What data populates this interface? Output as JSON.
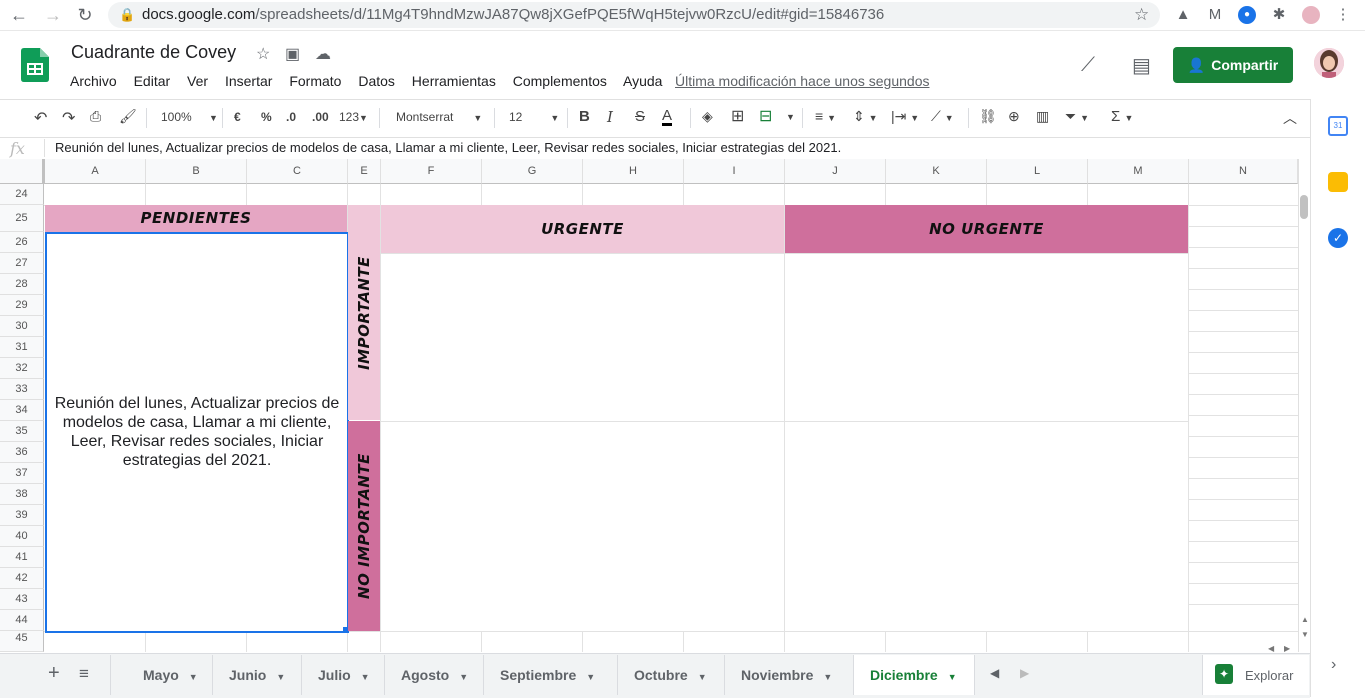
{
  "browser": {
    "url_domain": "docs.google.com",
    "url_path": "/spreadsheets/d/11Mg4T9hndMzwJA87Qw8jXGefPQE5fWqH5tejvw0RzcU/edit#gid=15846736"
  },
  "doc": {
    "title": "Cuadrante de Covey",
    "menus": [
      "Archivo",
      "Editar",
      "Ver",
      "Insertar",
      "Formato",
      "Datos",
      "Herramientas",
      "Complementos",
      "Ayuda"
    ],
    "last_modified": "Última modificación hace unos segundos",
    "share_label": "Compartir"
  },
  "toolbar": {
    "zoom": "100%",
    "currency": "€",
    "percent": "%",
    "dec_decrease": ".0",
    "dec_increase": ".00",
    "more_formats": "123",
    "font": "Montserrat",
    "font_size": "12",
    "bold": "B",
    "italic": "I",
    "strike": "S",
    "text_color": "A"
  },
  "formula": {
    "fx": "fx",
    "content": "Reunión del lunes, Actualizar precios de modelos de casa, Llamar a mi cliente, Leer, Revisar redes sociales, Iniciar estrategias del 2021."
  },
  "columns": [
    "A",
    "B",
    "C",
    "E",
    "F",
    "G",
    "H",
    "I",
    "J",
    "K",
    "L",
    "M",
    "N"
  ],
  "rows": [
    "24",
    "25",
    "26",
    "27",
    "28",
    "29",
    "30",
    "31",
    "32",
    "33",
    "34",
    "35",
    "36",
    "37",
    "38",
    "39",
    "40",
    "41",
    "42",
    "43",
    "44",
    "45"
  ],
  "matrix": {
    "pending_header": "PENDIENTES",
    "pending_text": "Reunión del lunes, Actualizar precios de modelos de casa, Llamar a mi cliente, Leer, Revisar redes sociales, Iniciar estrategias del 2021.",
    "urgent": "URGENTE",
    "not_urgent": "NO URGENTE",
    "important": "IMPORTANTE",
    "not_important": "NO IMPORTANTE",
    "colors": {
      "pending": "#e5a6c3",
      "light_pink": "#f0c8d9",
      "dark_pink": "#cf6f9c"
    }
  },
  "tabs": [
    "Mayo",
    "Junio",
    "Julio",
    "Agosto",
    "Septiembre",
    "Octubre",
    "Noviembre",
    "Diciembre"
  ],
  "active_tab": "Diciembre",
  "explore_label": "Explorar",
  "calendar_day": "31",
  "accent": "#188038"
}
